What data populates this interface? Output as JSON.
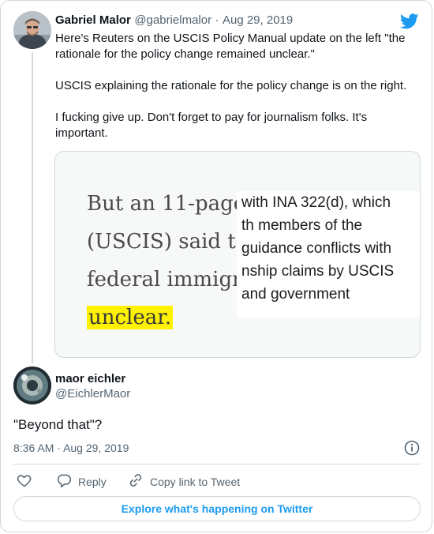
{
  "tweet": {
    "author_name": "Gabriel Malor",
    "handle": "@gabrielmalor",
    "separator": "·",
    "date": "Aug 29, 2019",
    "paragraphs": [
      "Here's Reuters on the USCIS Policy Manual update on the left \"the rationale for the policy change remained unclear.\"",
      "USCIS explaining the rationale for the policy change is on the right.",
      "I fucking give up. Don't forget to pay for journalism folks. It's important."
    ],
    "media": {
      "left_lines": [
        "But an 11-page",
        "(USCIS) said t",
        "federal immigr"
      ],
      "left_highlight": "unclear.",
      "right_lines": [
        "with INA 322(d), which",
        "th members of the",
        "guidance conflicts with",
        "nship claims by USCIS",
        "and government"
      ]
    }
  },
  "reply": {
    "author_name": "maor eichler",
    "handle": "@EichlerMaor",
    "text": "\"Beyond that\"?",
    "time": "8:36 AM",
    "separator": "·",
    "date": "Aug 29, 2019"
  },
  "actions": {
    "reply_label": "Reply",
    "copy_link_label": "Copy link to Tweet"
  },
  "cta": {
    "label": "Explore what's happening on Twitter"
  },
  "colors": {
    "accent": "#1d9bf0",
    "highlight": "#fff200"
  },
  "icons": [
    "twitter-bird-icon",
    "info-icon",
    "heart-icon",
    "reply-icon",
    "link-icon"
  ]
}
